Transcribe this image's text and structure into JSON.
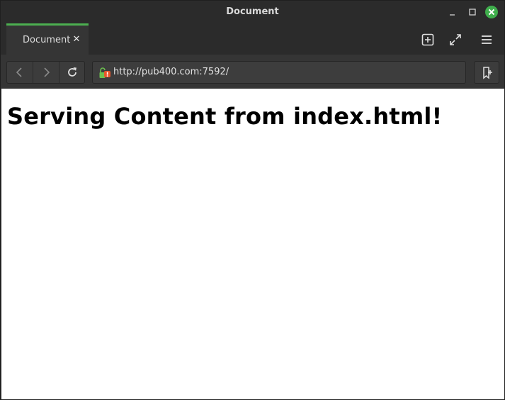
{
  "window": {
    "title": "Document"
  },
  "tabs": [
    {
      "label": "Document",
      "close_glyph": "✕",
      "active": true
    }
  ],
  "toolbar_icons": [
    "new-tab-icon",
    "fullscreen-icon",
    "hamburger-menu-icon"
  ],
  "navigation": {
    "back_icon": "chevron-left-icon",
    "forward_icon": "chevron-right-icon",
    "reload_icon": "reload-icon"
  },
  "address_bar": {
    "url": "http://pub400.com:7592/",
    "security_icon": "insecure-lock-warning-icon"
  },
  "bookmark_icon": "add-bookmark-icon",
  "page": {
    "heading": "Serving Content from index.html!"
  },
  "colors": {
    "accent": "#4caf50",
    "close_button": "#3fae4c",
    "chrome_dark": "#2b2b2b",
    "chrome_mid": "#353535",
    "page_background": "#ffffff"
  }
}
